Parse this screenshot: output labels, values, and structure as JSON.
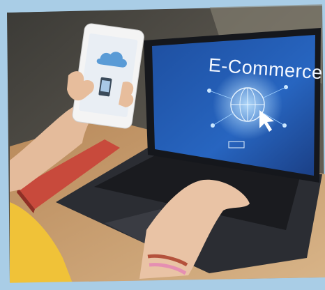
{
  "photo": {
    "screen_text": "E-Commerce"
  }
}
